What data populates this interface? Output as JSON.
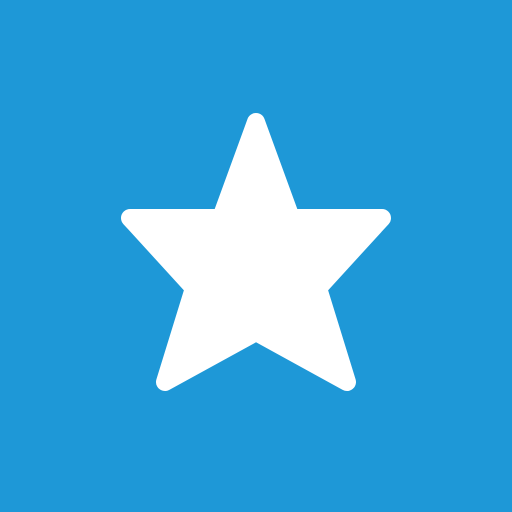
{
  "tile": {
    "icon": "star-icon",
    "background_color": "#1e98d7",
    "icon_color": "#ffffff"
  }
}
